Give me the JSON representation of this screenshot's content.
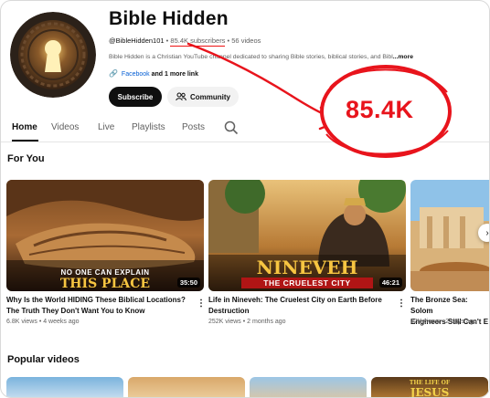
{
  "channel": {
    "name": "Bible Hidden",
    "handle": "@BibleHidden101",
    "subscribers": "85.4K subscribers",
    "videos": "56 videos",
    "separator": "•",
    "description": "Bible Hidden is a Christian YouTube channel dedicated to sharing Bible stories, biblical stories, and Bibl",
    "description_more": "...more",
    "link_primary": "Facebook",
    "link_more": "and 1 more link",
    "subscribe_label": "Subscribe",
    "community_label": "Community"
  },
  "annotation": {
    "highlight_text": "85.4K",
    "color": "#e8141c"
  },
  "tabs": [
    "Home",
    "Videos",
    "Live",
    "Playlists",
    "Posts"
  ],
  "sections": {
    "for_you": "For You",
    "popular": "Popular videos"
  },
  "videos": [
    {
      "title_line1": "Why Is the World HIDING These Biblical Locations?",
      "title_line2": "The Truth They Don't Want You to Know",
      "views": "6.8K views",
      "age": "4 weeks ago",
      "duration": "35:50",
      "thumb_text_small": "NO ONE CAN EXPLAIN",
      "thumb_text_big": "THIS PLACE"
    },
    {
      "title_line1": "Life in Nineveh: The Cruelest City on Earth Before",
      "title_line2": "Destruction",
      "views": "252K views",
      "age": "2 months ago",
      "duration": "46:21",
      "thumb_text_big": "NINEVEH",
      "thumb_text_banner": "THE CRUELEST CITY"
    },
    {
      "title_line1": "The Bronze Sea: Solom",
      "title_line2": "Engineers Still Can't E",
      "views": "22K views",
      "age": "2 days ago"
    }
  ],
  "popular_thumbs": [
    {
      "text_top": "THE LIFE OF",
      "text_big": "JESUS"
    }
  ],
  "colors": {
    "accent_red": "#e8141c",
    "link_blue": "#065fd4",
    "subscribe_bg": "#0f0f0f"
  }
}
